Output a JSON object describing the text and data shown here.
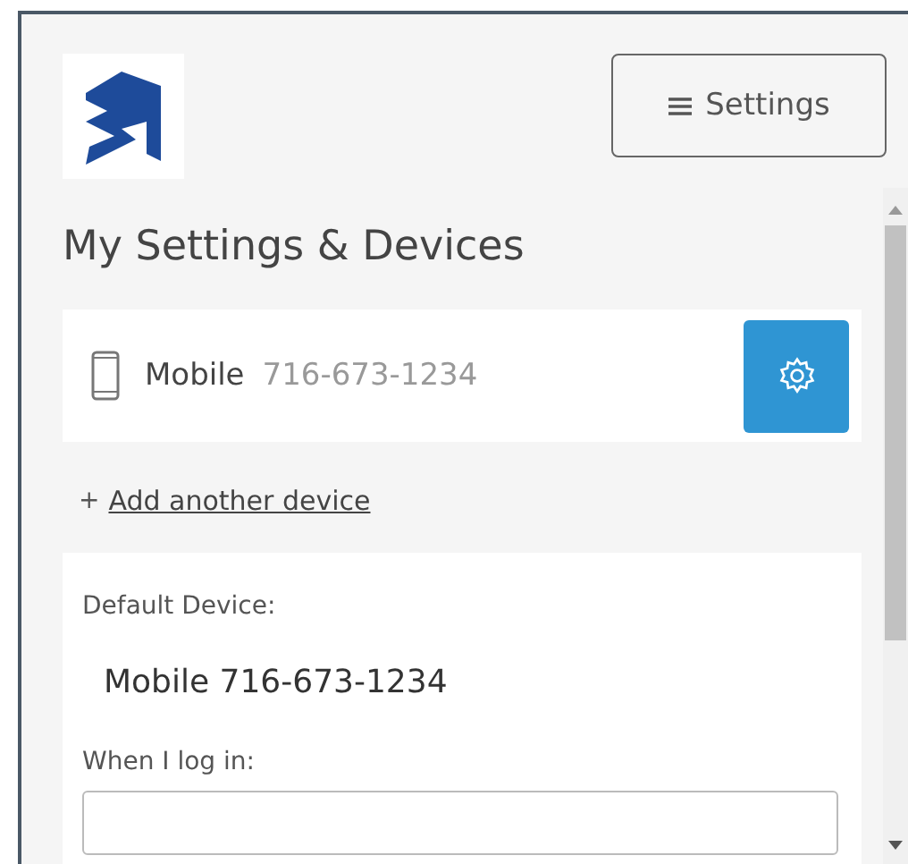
{
  "header": {
    "menu_button": "Settings"
  },
  "title": "My Settings & Devices",
  "devices": [
    {
      "type": "Mobile",
      "number": "716-673-1234"
    }
  ],
  "add_device_link": {
    "prefix": "+",
    "label": "Add another device"
  },
  "default_device": {
    "label": "Default Device:",
    "value": "Mobile 716-673-1234"
  },
  "login": {
    "label": "When I log in:"
  }
}
